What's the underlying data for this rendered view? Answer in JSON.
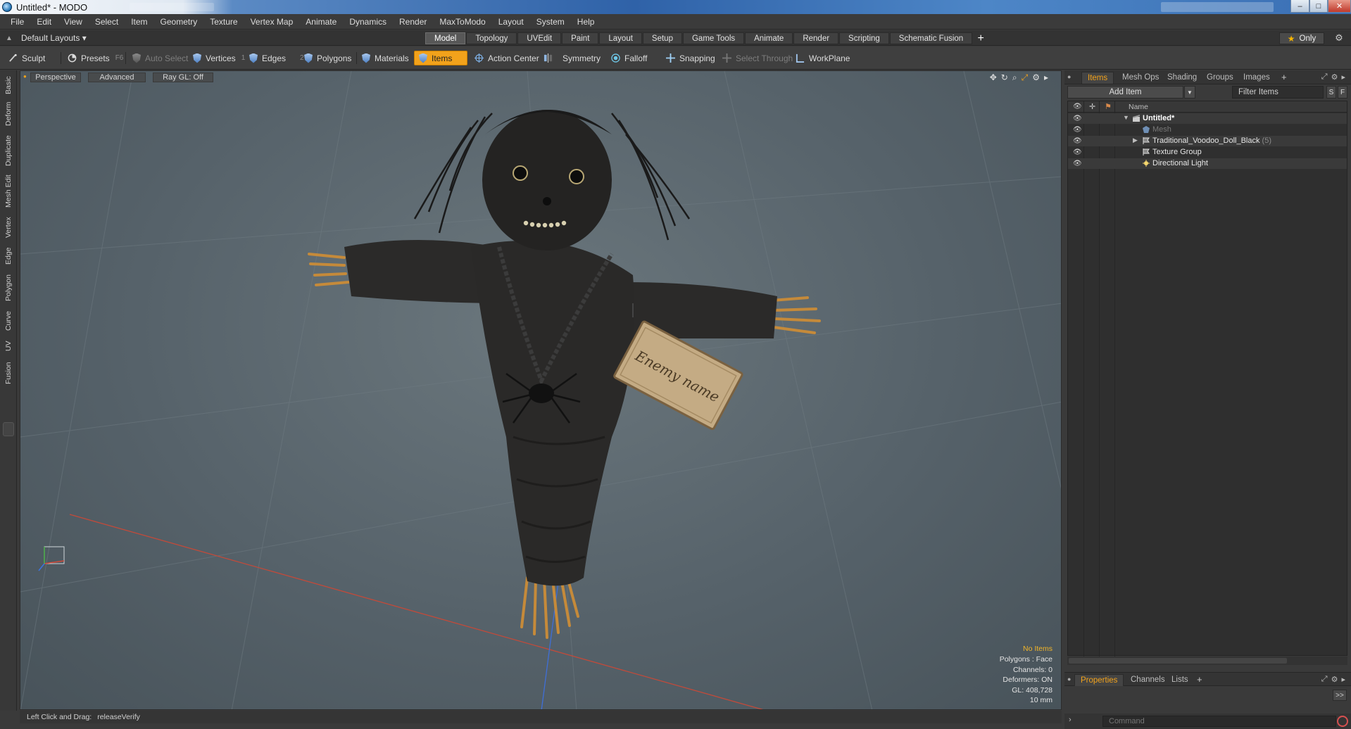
{
  "window": {
    "title": "Untitled* - MODO",
    "controls": {
      "minimize": "–",
      "maximize": "□",
      "close": "✕"
    }
  },
  "menu": [
    "File",
    "Edit",
    "View",
    "Select",
    "Item",
    "Geometry",
    "Texture",
    "Vertex Map",
    "Animate",
    "Dynamics",
    "Render",
    "MaxToModo",
    "Layout",
    "System",
    "Help"
  ],
  "layoutbar": {
    "layout_name": "Default Layouts ▾",
    "tabs": [
      "Model",
      "Topology",
      "UVEdit",
      "Paint",
      "Layout",
      "Setup",
      "Game Tools",
      "Animate",
      "Render",
      "Scripting",
      "Schematic Fusion"
    ],
    "active_tab": "Model",
    "only_label": "Only"
  },
  "toolbar": {
    "sculpt": "Sculpt",
    "presets": "Presets",
    "presets_key": "F6",
    "auto_select": "Auto Select",
    "vertices": "Vertices",
    "vertices_key": "1",
    "edges": "Edges",
    "edges_key": "2",
    "polygons": "Polygons",
    "materials": "Materials",
    "items": "Items",
    "action_center": "Action Center",
    "symmetry": "Symmetry",
    "falloff": "Falloff",
    "snapping": "Snapping",
    "select_through": "Select Through",
    "workplane": "WorkPlane"
  },
  "left_tabs": [
    "Basic",
    "Deform",
    "Duplicate",
    "Mesh Edit",
    "Vertex",
    "Edge",
    "Polygon",
    "Curve",
    "UV",
    "Fusion"
  ],
  "viewport": {
    "view": "Perspective",
    "advanced": "Advanced",
    "raygl": "Ray GL: Off",
    "tag_text": "Enemy name",
    "stats": {
      "no_items": "No Items",
      "polygons": "Polygons : Face",
      "channels": "Channels: 0",
      "deformers": "Deformers: ON",
      "gl": "GL: 408,728",
      "scale": "10 mm"
    }
  },
  "status": {
    "hint": "Left Click and Drag:",
    "command": "releaseVerify"
  },
  "right_panel": {
    "tabs": [
      "Items",
      "Mesh Ops",
      "Shading",
      "Groups",
      "Images"
    ],
    "active_tab": "Items",
    "add_item": "Add Item",
    "filter_items": "Filter Items",
    "s_btn": "S",
    "f_btn": "F",
    "name_header": "Name",
    "tree": [
      {
        "label": "Untitled*",
        "style": "bold",
        "expander": "▼"
      },
      {
        "label": "Mesh",
        "style": "dim",
        "expander": ""
      },
      {
        "label": "Traditional_Voodoo_Doll_Black",
        "count": "(5)",
        "style": "normal",
        "expander": "▶"
      },
      {
        "label": "Texture Group",
        "style": "normal",
        "expander": ""
      },
      {
        "label": "Directional Light",
        "style": "normal",
        "expander": ""
      }
    ],
    "bottom_tabs": [
      "Properties",
      "Channels",
      "Lists"
    ],
    "bottom_active": "Properties",
    "more": ">>",
    "command_placeholder": "Command"
  }
}
